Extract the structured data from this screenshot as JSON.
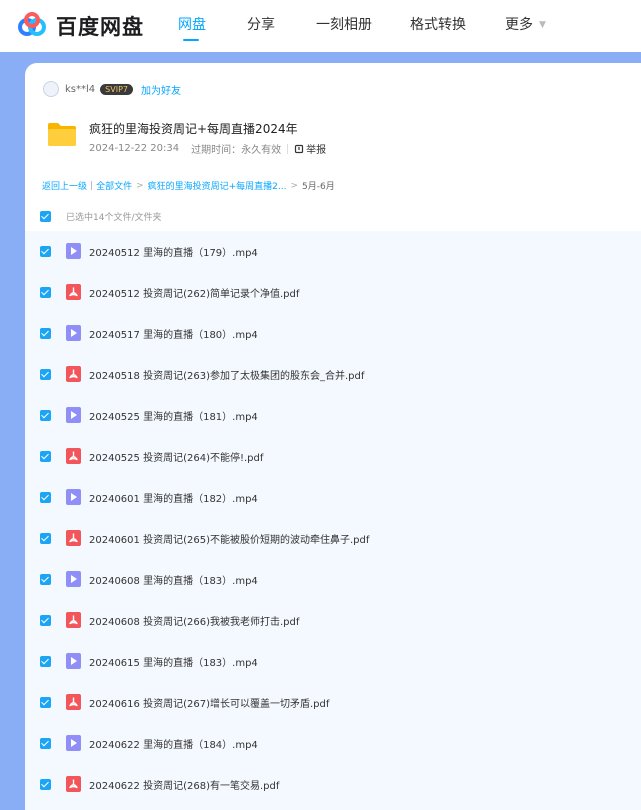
{
  "header": {
    "logo_text": "百度网盘",
    "nav": [
      {
        "label": "网盘",
        "active": true
      },
      {
        "label": "分享",
        "active": false
      },
      {
        "label": "一刻相册",
        "active": false
      },
      {
        "label": "格式转换",
        "active": false
      },
      {
        "label": "更多",
        "active": false
      }
    ]
  },
  "share": {
    "username": "ks**l4",
    "vip_badge": "SVIP7",
    "add_friend": "加为好友",
    "folder_title": "疯狂的里海投资周记+每周直播2024年",
    "date": "2024-12-22 20:34",
    "expire": "过期时间：永久有效",
    "report": "举报"
  },
  "breadcrumb": {
    "back": "返回上一级",
    "all": "全部文件",
    "parent": "疯狂的里海投资周记+每周直播2...",
    "current": "5月-6月"
  },
  "selection": {
    "label": "已选中14个文件/文件夹"
  },
  "files": [
    {
      "name": "20240512 里海的直播（179）.mp4",
      "type": "video",
      "icon": "video-file-icon"
    },
    {
      "name": "20240512 投资周记(262)简单记录个净值.pdf",
      "type": "pdf",
      "icon": "pdf-file-icon"
    },
    {
      "name": "20240517 里海的直播（180）.mp4",
      "type": "video",
      "icon": "video-file-icon"
    },
    {
      "name": "20240518 投资周记(263)参加了太极集团的股东会_合并.pdf",
      "type": "pdf",
      "icon": "pdf-file-icon"
    },
    {
      "name": "20240525 里海的直播（181）.mp4",
      "type": "video",
      "icon": "video-file-icon"
    },
    {
      "name": "20240525 投资周记(264)不能停!.pdf",
      "type": "pdf",
      "icon": "pdf-file-icon"
    },
    {
      "name": "20240601 里海的直播（182）.mp4",
      "type": "video",
      "icon": "video-file-icon"
    },
    {
      "name": "20240601 投资周记(265)不能被股价短期的波动牵住鼻子.pdf",
      "type": "pdf",
      "icon": "pdf-file-icon"
    },
    {
      "name": "20240608 里海的直播（183）.mp4",
      "type": "video",
      "icon": "video-file-icon"
    },
    {
      "name": "20240608 投资周记(266)我被我老师打击.pdf",
      "type": "pdf",
      "icon": "pdf-file-icon"
    },
    {
      "name": "20240615 里海的直播（183）.mp4",
      "type": "video",
      "icon": "video-file-icon"
    },
    {
      "name": "20240616 投资周记(267)增长可以覆盖一切矛盾.pdf",
      "type": "pdf",
      "icon": "pdf-file-icon"
    },
    {
      "name": "20240622 里海的直播（184）.mp4",
      "type": "video",
      "icon": "video-file-icon"
    },
    {
      "name": "20240622 投资周记(268)有一笔交易.pdf",
      "type": "pdf",
      "icon": "pdf-file-icon"
    }
  ],
  "colors": {
    "accent": "#06a7ff",
    "band": "#8aaef6",
    "list_bg": "#f4f9ff",
    "pdf": "#f2555a",
    "video": "#8f8ff7"
  }
}
